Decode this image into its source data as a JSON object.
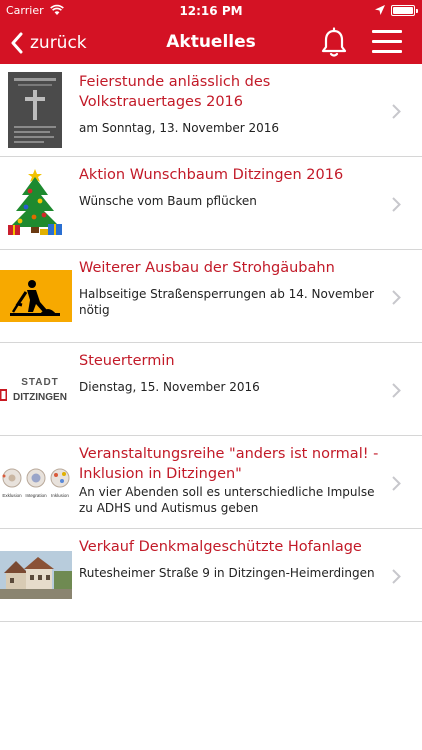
{
  "status": {
    "carrier": "Carrier",
    "time": "12:16 PM",
    "battery_level": 1.0
  },
  "nav": {
    "back_label": "zurück",
    "title": "Aktuelles"
  },
  "items": [
    {
      "title": "Feierstunde anlässlich des Volkstrauertages 2016",
      "subtitle": "am Sonntag, 13. November 2016",
      "thumbnail": "event-poster"
    },
    {
      "title": "Aktion Wunschbaum Ditzingen 2016",
      "subtitle": "Wünsche vom Baum pflücken",
      "thumbnail": "christmas-tree"
    },
    {
      "title": "Weiterer Ausbau der Strohgäubahn",
      "subtitle": "Halbseitige Straßensperrungen ab 14. November nötig",
      "thumbnail": "road-works-sign"
    },
    {
      "title": "Steuertermin",
      "subtitle": "Dienstag, 15. November 2016",
      "thumbnail": "stadt-ditzingen-logo",
      "logo_text": [
        "STADT",
        "DITZINGEN"
      ]
    },
    {
      "title": "Veranstaltungsreihe \"anders ist normal! - Inklusion in Ditzingen\"",
      "subtitle": "An vier Abenden soll es unterschiedliche Impulse zu ADHS und Autismus geben",
      "thumbnail": "inclusion-diagram",
      "thumb_labels": [
        "Exklusion",
        "Integration",
        "Inklusion"
      ]
    },
    {
      "title": "Verkauf Denkmalgeschützte Hofanlage",
      "subtitle": "Rutesheimer Straße 9 in Ditzingen-Heimerdingen",
      "thumbnail": "farmhouse-photo"
    }
  ]
}
